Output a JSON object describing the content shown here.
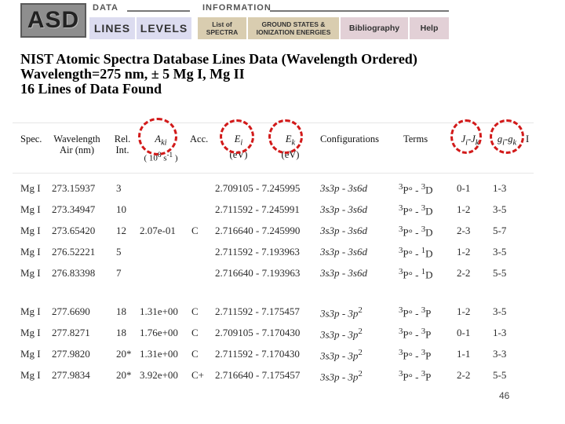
{
  "banner": {
    "logo": "ASD",
    "data_header": "DATA",
    "information_header": "INFORMATION",
    "nav": {
      "lines": "LINES",
      "levels": "LEVELS",
      "list_line1": "List of",
      "list_line2": "SPECTRA",
      "ground_line1": "GROUND STATES &",
      "ground_line2": "IONIZATION ENERGIES",
      "bibliography": "Bibliography",
      "help": "Help"
    }
  },
  "titles": {
    "line1": "NIST Atomic Spectra Database Lines Data (Wavelength Ordered)",
    "line2": "Wavelength=275 nm, ± 5   Mg I, Mg II",
    "line3": "16 Lines of Data Found"
  },
  "headers": {
    "spec": "Spec.",
    "wavelength_1": "Wavelength",
    "wavelength_2": "Air (nm)",
    "rel_1": "Rel.",
    "rel_2": "Int.",
    "aki_1": "A",
    "aki_sub": "ki",
    "aki_2": "( 10",
    "aki_sup": "8",
    "aki_3": " s",
    "aki_sup2": "-1",
    "aki_4": " )",
    "acc": "Acc.",
    "ei": "E",
    "ei_sub": "i",
    "ei_unit": "(eV)",
    "ek": "E",
    "ek_sub": "k",
    "ek_unit": "(eV)",
    "configurations": "Configurations",
    "terms": "Terms",
    "j": "J",
    "j_sub1": "i",
    "j_mid": "-J",
    "j_sub2": "k",
    "g": "g",
    "g_sub1": "i",
    "g_mid": "-g",
    "g_sub2": "k",
    "last": "I"
  },
  "rows": [
    {
      "spec": "Mg I",
      "wl": "273.15937",
      "rel": "3",
      "aki": "",
      "acc": "",
      "ei": "2.709105",
      "ek": "7.245995",
      "c1": "3s3p",
      "c2": "3s6d",
      "t1": "P°",
      "t1s": "3",
      "t2": "D",
      "t2s": "3",
      "jj": "0-1",
      "gg": "1-3"
    },
    {
      "spec": "Mg I",
      "wl": "273.34947",
      "rel": "10",
      "aki": "",
      "acc": "",
      "ei": "2.711592",
      "ek": "7.245991",
      "c1": "3s3p",
      "c2": "3s6d",
      "t1": "P°",
      "t1s": "3",
      "t2": "D",
      "t2s": "3",
      "jj": "1-2",
      "gg": "3-5"
    },
    {
      "spec": "Mg I",
      "wl": "273.65420",
      "rel": "12",
      "aki": "2.07e-01",
      "acc": "C",
      "ei": "2.716640",
      "ek": "7.245990",
      "c1": "3s3p",
      "c2": "3s6d",
      "t1": "P°",
      "t1s": "3",
      "t2": "D",
      "t2s": "3",
      "jj": "2-3",
      "gg": "5-7"
    },
    {
      "spec": "Mg I",
      "wl": "276.52221",
      "rel": "5",
      "aki": "",
      "acc": "",
      "ei": "2.711592",
      "ek": "7.193963",
      "c1": "3s3p",
      "c2": "3s6d",
      "t1": "P°",
      "t1s": "3",
      "t2": "D",
      "t2s": "1",
      "jj": "1-2",
      "gg": "3-5"
    },
    {
      "spec": "Mg I",
      "wl": "276.83398",
      "rel": "7",
      "aki": "",
      "acc": "",
      "ei": "2.716640",
      "ek": "7.193963",
      "c1": "3s3p",
      "c2": "3s6d",
      "t1": "P°",
      "t1s": "3",
      "t2": "D",
      "t2s": "1",
      "jj": "2-2",
      "gg": "5-5"
    },
    {
      "spec": "Mg I",
      "wl": "277.6690",
      "rel": "18",
      "aki": "1.31e+00",
      "acc": "C",
      "ei": "2.711592",
      "ek": "7.175457",
      "c1": "3s3p",
      "c2": "3p",
      "c2sup": "2",
      "t1": "P°",
      "t1s": "3",
      "t2": "P",
      "t2s": "3",
      "jj": "1-2",
      "gg": "3-5"
    },
    {
      "spec": "Mg I",
      "wl": "277.8271",
      "rel": "18",
      "aki": "1.76e+00",
      "acc": "C",
      "ei": "2.709105",
      "ek": "7.170430",
      "c1": "3s3p",
      "c2": "3p",
      "c2sup": "2",
      "t1": "P°",
      "t1s": "3",
      "t2": "P",
      "t2s": "3",
      "jj": "0-1",
      "gg": "1-3"
    },
    {
      "spec": "Mg I",
      "wl": "277.9820",
      "rel": "20*",
      "aki": "1.31e+00",
      "acc": "C",
      "ei": "2.711592",
      "ek": "7.170430",
      "c1": "3s3p",
      "c2": "3p",
      "c2sup": "2",
      "t1": "P°",
      "t1s": "3",
      "t2": "P",
      "t2s": "3",
      "jj": "1-1",
      "gg": "3-3"
    },
    {
      "spec": "Mg I",
      "wl": "277.9834",
      "rel": "20*",
      "aki": "3.92e+00",
      "acc": "C+",
      "ei": "2.716640",
      "ek": "7.175457",
      "c1": "3s3p",
      "c2": "3p",
      "c2sup": "2",
      "t1": "P°",
      "t1s": "3",
      "t2": "P",
      "t2s": "3",
      "jj": "2-2",
      "gg": "5-5"
    }
  ],
  "page_number": "46",
  "colors": {
    "highlight_ring": "#d21a1a",
    "nav_blue": "#dcdcf0",
    "nav_tan": "#d9cdb0",
    "nav_pink": "#e2d0d6"
  }
}
